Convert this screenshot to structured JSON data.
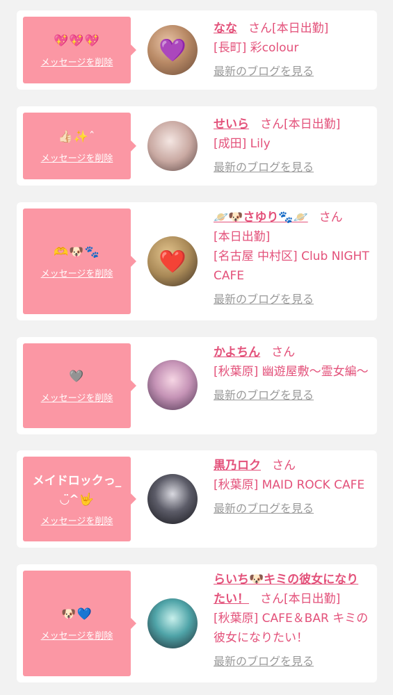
{
  "colors": {
    "page_bg": "#f2f2f2",
    "card_bg": "#ffffff",
    "bubble_pink": "#fb97a4",
    "accent_pink": "#e3517a",
    "link_gray": "#9a9a9a"
  },
  "delete_label": "メッセージを削除",
  "blog_label": "最新のブログを見る",
  "san_label": "さん",
  "today_badge": "[本日出勤]",
  "cards": [
    {
      "message": "💖💖💖",
      "name": "なな",
      "working_today": true,
      "shop": "[長町] 彩colour",
      "avatar_decoration": "💜"
    },
    {
      "message": "👍🏻✨ˆ",
      "name": "せいら",
      "working_today": true,
      "shop": "[成田] Lily",
      "avatar_decoration": ""
    },
    {
      "message": "🫶🐶🐾",
      "name": "🪐🐶さゆり🐾🪐",
      "working_today": true,
      "shop": "[名古屋 中村区] Club NIGHT CAFE",
      "avatar_decoration": "❤️"
    },
    {
      "message": "🩶",
      "name": "かよちん",
      "working_today": false,
      "shop": "[秋葉原] 幽遊屋敷〜霊女編〜",
      "avatar_decoration": ""
    },
    {
      "message": "メイドロックっ_ ◡̈^🤟",
      "name": "黒乃ロク",
      "working_today": false,
      "shop": "[秋葉原] MAID ROCK CAFE",
      "avatar_decoration": ""
    },
    {
      "message": "🐶💙",
      "name": "らいち🐶キミの彼女になりたい！",
      "working_today": true,
      "shop": "[秋葉原] CAFE＆BAR キミの彼女になりたい！",
      "avatar_decoration": ""
    }
  ]
}
